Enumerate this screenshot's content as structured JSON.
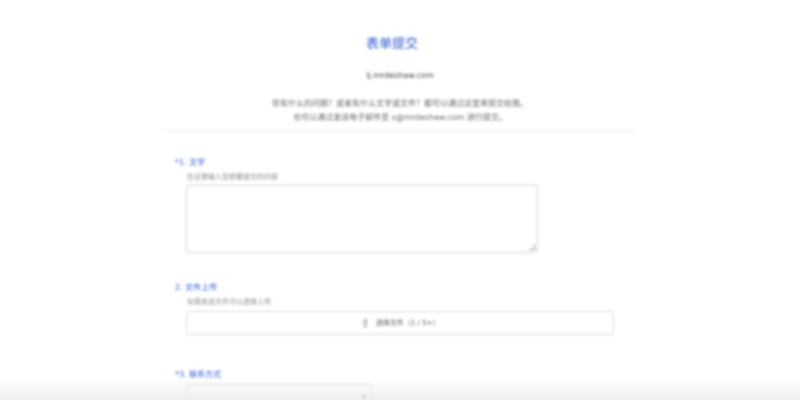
{
  "form": {
    "title": "表单提交",
    "subtitle": "lj.mrdeshaw.com",
    "description_line1": "您有什么的问题？或者有什么文字或文件？都可以通过这里来提交给我。",
    "description_line2": "也可以通过发送电子邮件至 s@mrdeshaw.com 进行提交。"
  },
  "questions": [
    {
      "label": "*1. 文字",
      "hint": "在这里输入您想要提交的内容",
      "input_value": ""
    },
    {
      "label": "2. 文件上传",
      "hint": "如需发送文件可以选择上传",
      "button_label": "选择文件（1 / 5+）"
    },
    {
      "label": "*3. 联系方式",
      "selected_value": ""
    }
  ],
  "icons": {
    "upload": "upload-icon",
    "dropdown": "chevron-down-icon"
  },
  "colors": {
    "accent": "#2d5bd6",
    "text": "#333333",
    "muted": "#888888",
    "border": "#cfd3da"
  }
}
